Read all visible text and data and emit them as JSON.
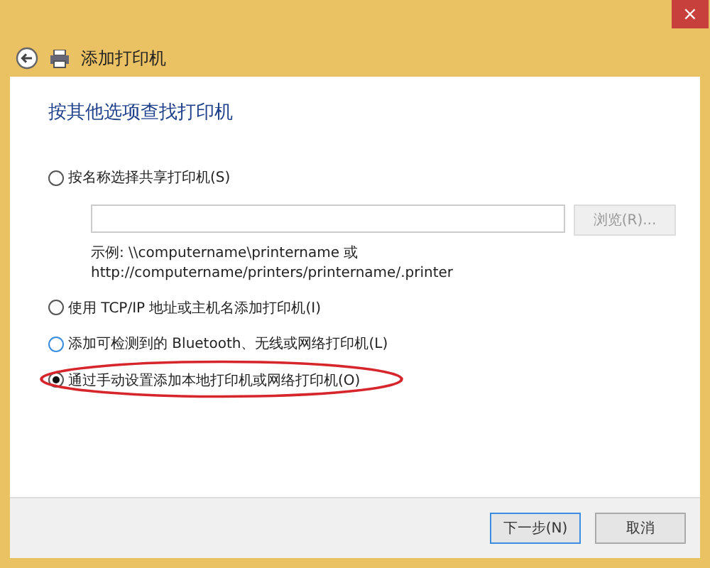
{
  "window": {
    "close": "×"
  },
  "header": {
    "title": "添加打印机"
  },
  "heading": "按其他选项查找打印机",
  "options": [
    {
      "label": "按名称选择共享打印机(S)",
      "selected": false,
      "color": "#555555",
      "circled": false,
      "share_field": {
        "browse": "浏览(R)...",
        "example": [
          "示例: \\\\computername\\printername 或",
          "http://computername/printers/printername/.printer"
        ]
      }
    },
    {
      "label": "使用 TCP/IP 地址或主机名添加打印机(I)",
      "selected": false,
      "color": "#555555",
      "circled": false
    },
    {
      "label": "添加可检测到的 Bluetooth、无线或网络打印机(L)",
      "selected": false,
      "color": "#3a8de0",
      "circled": false
    },
    {
      "label": "通过手动设置添加本地打印机或网络打印机(O)",
      "selected": true,
      "color": "#555555",
      "circled": true
    }
  ],
  "buttons": [
    {
      "label": "下一步(N)",
      "default": true
    },
    {
      "label": "取消",
      "default": false
    }
  ]
}
